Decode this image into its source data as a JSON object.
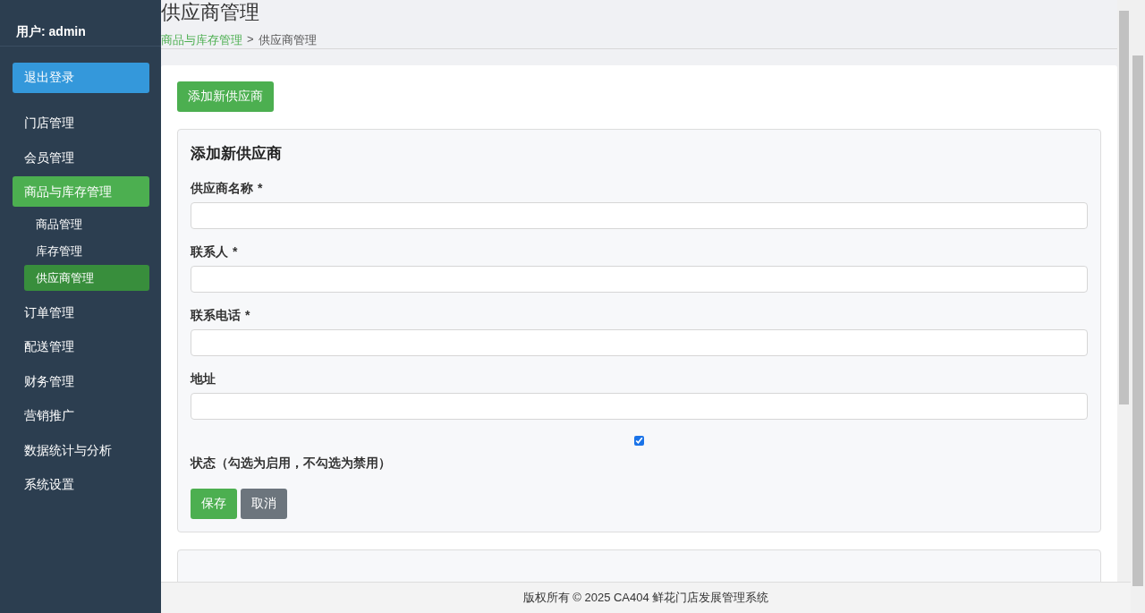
{
  "sidebar": {
    "user": "用户: admin",
    "logout": "退出登录",
    "items": [
      {
        "label": "门店管理",
        "selected": false
      },
      {
        "label": "会员管理",
        "selected": false
      },
      {
        "label": "商品与库存管理",
        "selected": true,
        "children": [
          {
            "label": "商品管理",
            "selected": false
          },
          {
            "label": "库存管理",
            "selected": false
          },
          {
            "label": "供应商管理",
            "selected": true
          }
        ]
      },
      {
        "label": "订单管理",
        "selected": false
      },
      {
        "label": "配送管理",
        "selected": false
      },
      {
        "label": "财务管理",
        "selected": false
      },
      {
        "label": "营销推广",
        "selected": false
      },
      {
        "label": "数据统计与分析",
        "selected": false
      },
      {
        "label": "系统设置",
        "selected": false
      }
    ]
  },
  "header": {
    "title": "供应商管理",
    "breadcrumb": [
      {
        "label": "商品与库存管理",
        "kind": "link"
      },
      {
        "label": ">",
        "kind": "separator"
      },
      {
        "label": "供应商管理",
        "kind": "current"
      }
    ]
  },
  "add_button": "添加新供应商",
  "form": {
    "title": "添加新供应商",
    "fields": [
      {
        "label": "供应商名称",
        "mark": "*"
      },
      {
        "label": "联系人",
        "mark": "*"
      },
      {
        "label": "联系电话",
        "mark": "*"
      },
      {
        "label": "地址"
      }
    ],
    "status": {
      "label": "状态（勾选为启用，不勾选为禁用）",
      "checked": true
    },
    "buttons": [
      {
        "label": "保存",
        "kind": "primary"
      },
      {
        "label": "取消",
        "kind": "secondary"
      }
    ]
  },
  "footer": "版权所有 © 2025 CA404 鲜花门店发展管理系统"
}
